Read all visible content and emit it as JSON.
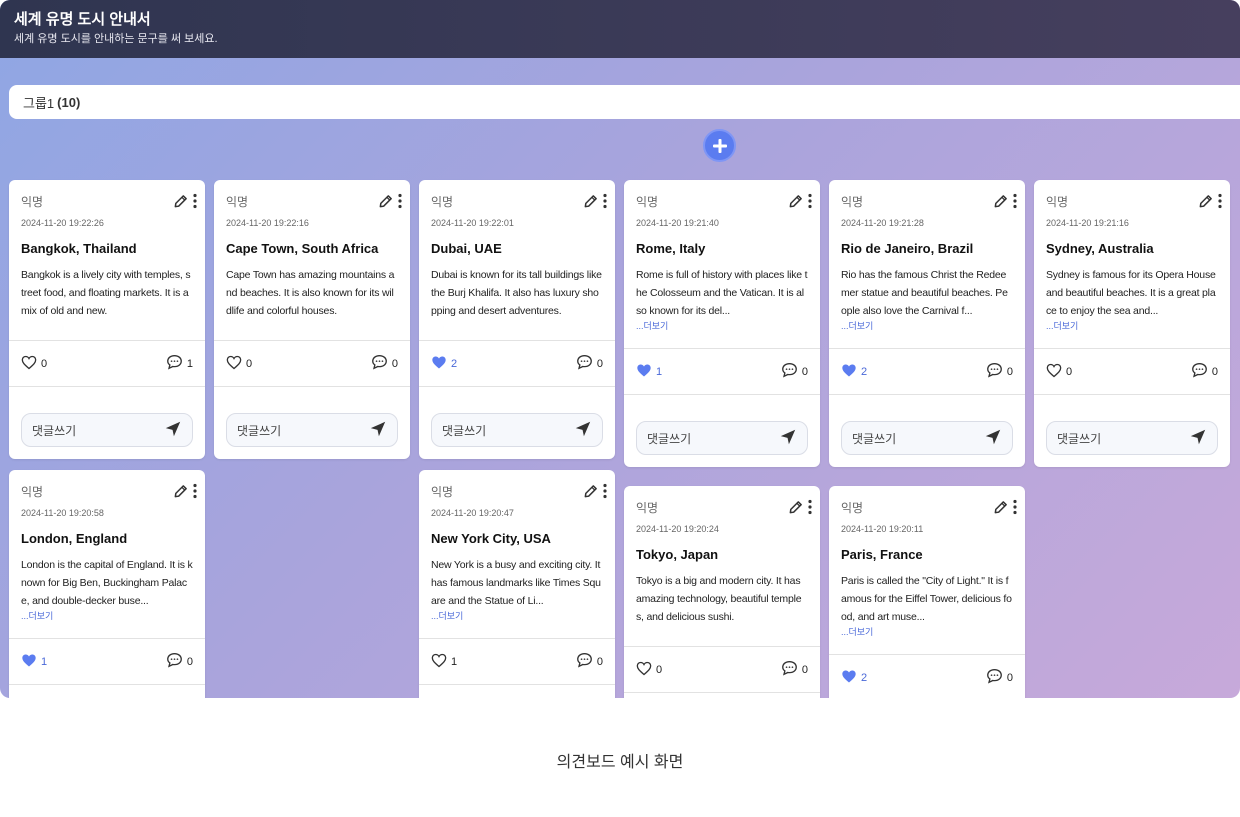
{
  "header": {
    "title": "세계 유명 도시 안내서",
    "subtitle": "세계 유명 도시를 안내하는 문구를 써 보세요."
  },
  "group": {
    "name": "그룹1",
    "count": "(10)"
  },
  "comment_placeholder": "댓글쓰기",
  "more_label": "...더보기",
  "colors": {
    "accent": "#5b7cf0",
    "liked": "#5b7cf0"
  },
  "cards": [
    {
      "author": "익명",
      "date": "2024-11-20 19:22:26",
      "title": "Bangkok, Thailand",
      "body": "Bangkok is a lively city with temples, street food, and floating markets. It is a mix of old and new.",
      "likes": "0",
      "comments": "1",
      "liked": false,
      "more": false
    },
    {
      "author": "익명",
      "date": "2024-11-20 19:22:16",
      "title": "Cape Town, South Africa",
      "body": "Cape Town has amazing mountains and beaches. It is also known for its wildlife and colorful houses.",
      "likes": "0",
      "comments": "0",
      "liked": false,
      "more": false
    },
    {
      "author": "익명",
      "date": "2024-11-20 19:22:01",
      "title": "Dubai, UAE",
      "body": "Dubai is known for its tall buildings like the Burj Khalifa. It also has luxury shopping and desert adventures.",
      "likes": "2",
      "comments": "0",
      "liked": true,
      "more": false
    },
    {
      "author": "익명",
      "date": "2024-11-20 19:21:40",
      "title": "Rome, Italy",
      "body": "Rome is full of history with places like the Colosseum and the Vatican. It is also known for its del...",
      "likes": "1",
      "comments": "0",
      "liked": true,
      "more": true
    },
    {
      "author": "익명",
      "date": "2024-11-20 19:21:28",
      "title": "Rio de Janeiro, Brazil",
      "body": "Rio has the famous Christ the Redeemer statue and beautiful beaches. People also love the Carnival f...",
      "likes": "2",
      "comments": "0",
      "liked": true,
      "more": true
    },
    {
      "author": "익명",
      "date": "2024-11-20 19:21:16",
      "title": "Sydney, Australia",
      "body": "Sydney is famous for its Opera House and beautiful beaches. It is a great place to enjoy the sea and...",
      "likes": "0",
      "comments": "0",
      "liked": false,
      "more": true
    },
    {
      "author": "익명",
      "date": "2024-11-20 19:20:58",
      "title": "London, England",
      "body": "London is the capital of England. It is known for Big Ben, Buckingham Palace, and double-decker buse...",
      "likes": "1",
      "comments": "0",
      "liked": true,
      "more": true
    },
    {
      "author": "익명",
      "date": "2024-11-20 19:20:47",
      "title": "New York City, USA",
      "body": "New York is a busy and exciting city. It has famous landmarks like Times Square and the Statue of Li...",
      "likes": "1",
      "comments": "0",
      "liked": false,
      "more": true
    },
    {
      "author": "익명",
      "date": "2024-11-20 19:20:24",
      "title": "Tokyo, Japan",
      "body": "Tokyo is a big and modern city. It has amazing technology, beautiful temples, and delicious sushi.",
      "likes": "0",
      "comments": "0",
      "liked": false,
      "more": false
    },
    {
      "author": "익명",
      "date": "2024-11-20 19:20:11",
      "title": "Paris, France",
      "body": "Paris is called the \"City of Light.\" It is famous for the Eiffel Tower, delicious food, and art muse...",
      "likes": "2",
      "comments": "0",
      "liked": true,
      "more": true
    }
  ],
  "caption": "의견보드 예시 화면"
}
